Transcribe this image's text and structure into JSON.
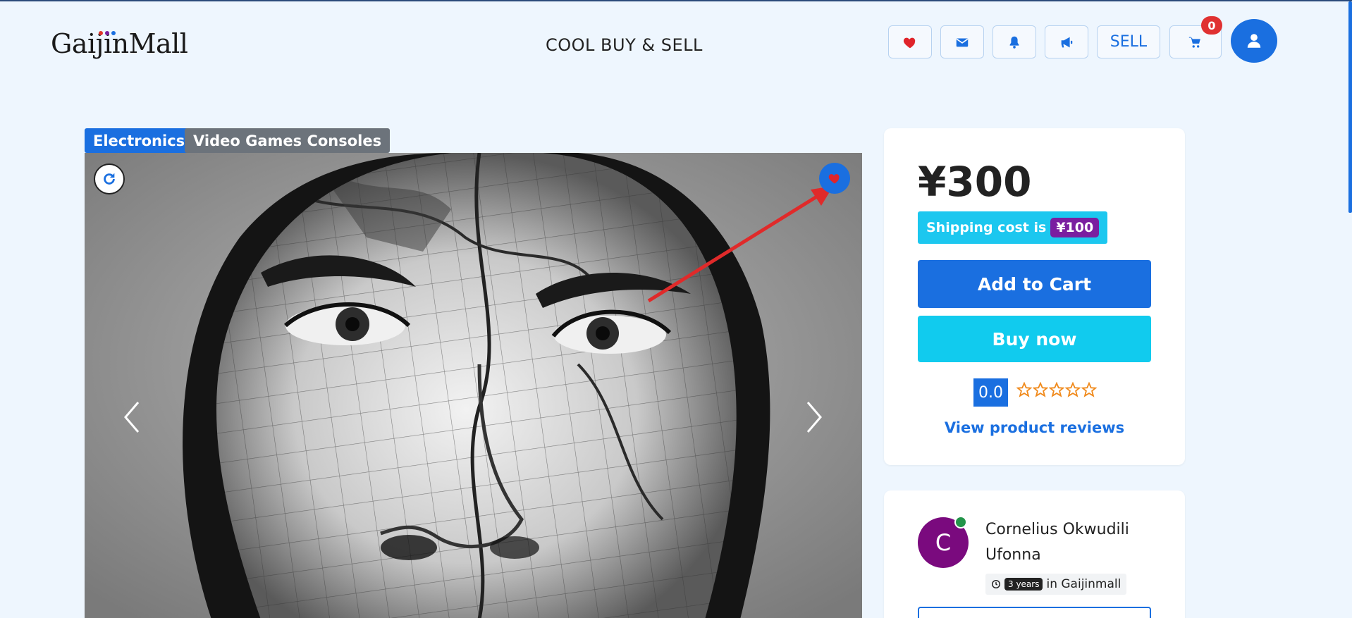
{
  "header": {
    "logo": "GaijinMall",
    "tagline": "COOL BUY & SELL",
    "sell_label": "SELL",
    "cart_count": "0"
  },
  "breadcrumb": {
    "category": "Electronics",
    "subcategory": "Video Games Consoles"
  },
  "product": {
    "price": "¥300",
    "shipping_label": "Shipping cost is",
    "shipping_cost": "¥100",
    "add_to_cart": "Add to Cart",
    "buy_now": "Buy now",
    "rating": "0.0",
    "rating_stars": 0,
    "reviews_link": "View product reviews"
  },
  "seller": {
    "initial": "C",
    "name": "Cornelius Okwudili Ufonna",
    "years": "3 years",
    "member_suffix": "in Gaijinmall"
  },
  "colors": {
    "primary": "#1a6fe0",
    "info": "#11cbee",
    "accent_purple": "#7a1ea0",
    "badge_red": "#e03131",
    "annotation_arrow": "#e02a2a"
  },
  "icons": [
    "heart-icon",
    "mail-icon",
    "bell-icon",
    "megaphone-icon",
    "cart-icon",
    "user-icon",
    "refresh-icon",
    "chevron-left-icon",
    "chevron-right-icon",
    "clock-icon",
    "star-icon"
  ]
}
